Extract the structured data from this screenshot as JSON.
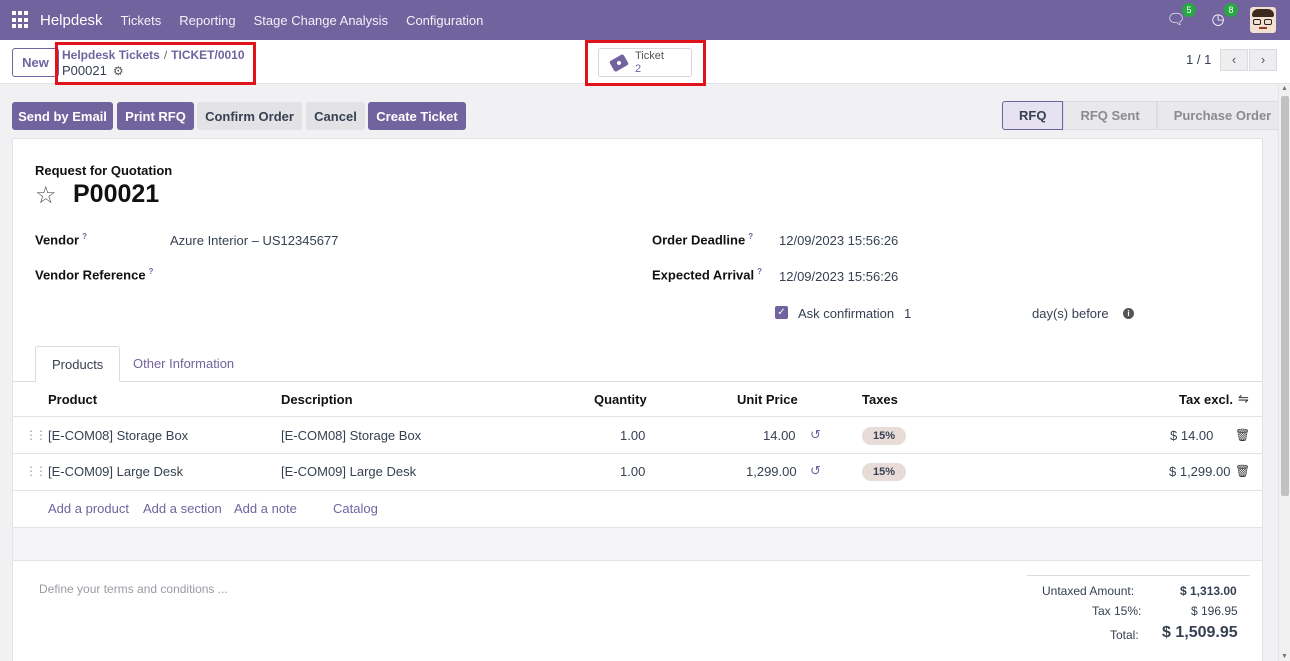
{
  "topbar": {
    "brand": "Helpdesk",
    "menu": [
      "Tickets",
      "Reporting",
      "Stage Change Analysis",
      "Configuration"
    ],
    "chat_count": "5",
    "activity_count": "8"
  },
  "control": {
    "new_label": "New",
    "breadcrumb": [
      "Helpdesk Tickets",
      "TICKET/0010"
    ],
    "breadcrumb_sep": "/",
    "record_name": "P00021",
    "smart_button": {
      "label": "Ticket",
      "value": "2"
    },
    "pager": "1 / 1"
  },
  "actions": [
    "Send by Email",
    "Print RFQ",
    "Confirm Order",
    "Cancel",
    "Create Ticket"
  ],
  "status_stages": [
    "RFQ",
    "RFQ Sent",
    "Purchase Order"
  ],
  "form": {
    "type_label": "Request for Quotation",
    "name": "P00021",
    "vendor_label": "Vendor",
    "vendor_value": "Azure Interior – US12345677",
    "vendor_ref_label": "Vendor Reference",
    "order_deadline_label": "Order Deadline",
    "order_deadline_value": "12/09/2023 15:56:26",
    "expected_arrival_label": "Expected Arrival",
    "expected_arrival_value": "12/09/2023 15:56:26",
    "ask_confirmation_label": "Ask confirmation",
    "ask_confirmation_days": "1",
    "days_before_label": "day(s) before",
    "help_mark": "?"
  },
  "tabs": [
    "Products",
    "Other Information"
  ],
  "table": {
    "headers": [
      "Product",
      "Description",
      "Quantity",
      "Unit Price",
      "Taxes",
      "Tax excl."
    ],
    "rows": [
      {
        "product": "[E-COM08] Storage Box",
        "description": "[E-COM08] Storage Box",
        "quantity": "1.00",
        "unit_price": "14.00",
        "tax": "15%",
        "subtotal": "$ 14.00"
      },
      {
        "product": "[E-COM09] Large Desk",
        "description": "[E-COM09] Large Desk",
        "quantity": "1.00",
        "unit_price": "1,299.00",
        "tax": "15%",
        "subtotal": "$ 1,299.00"
      }
    ],
    "add_links": [
      "Add a product",
      "Add a section",
      "Add a note",
      "Catalog"
    ]
  },
  "terms_placeholder": "Define your terms and conditions ...",
  "totals": {
    "untaxed_label": "Untaxed Amount:",
    "untaxed_value": "$ 1,313.00",
    "tax_label": "Tax 15%:",
    "tax_value": "$ 196.95",
    "total_label": "Total:",
    "total_value": "$ 1,509.95"
  },
  "colors": {
    "brand": "#71639e",
    "highlight": "#e0121a"
  }
}
